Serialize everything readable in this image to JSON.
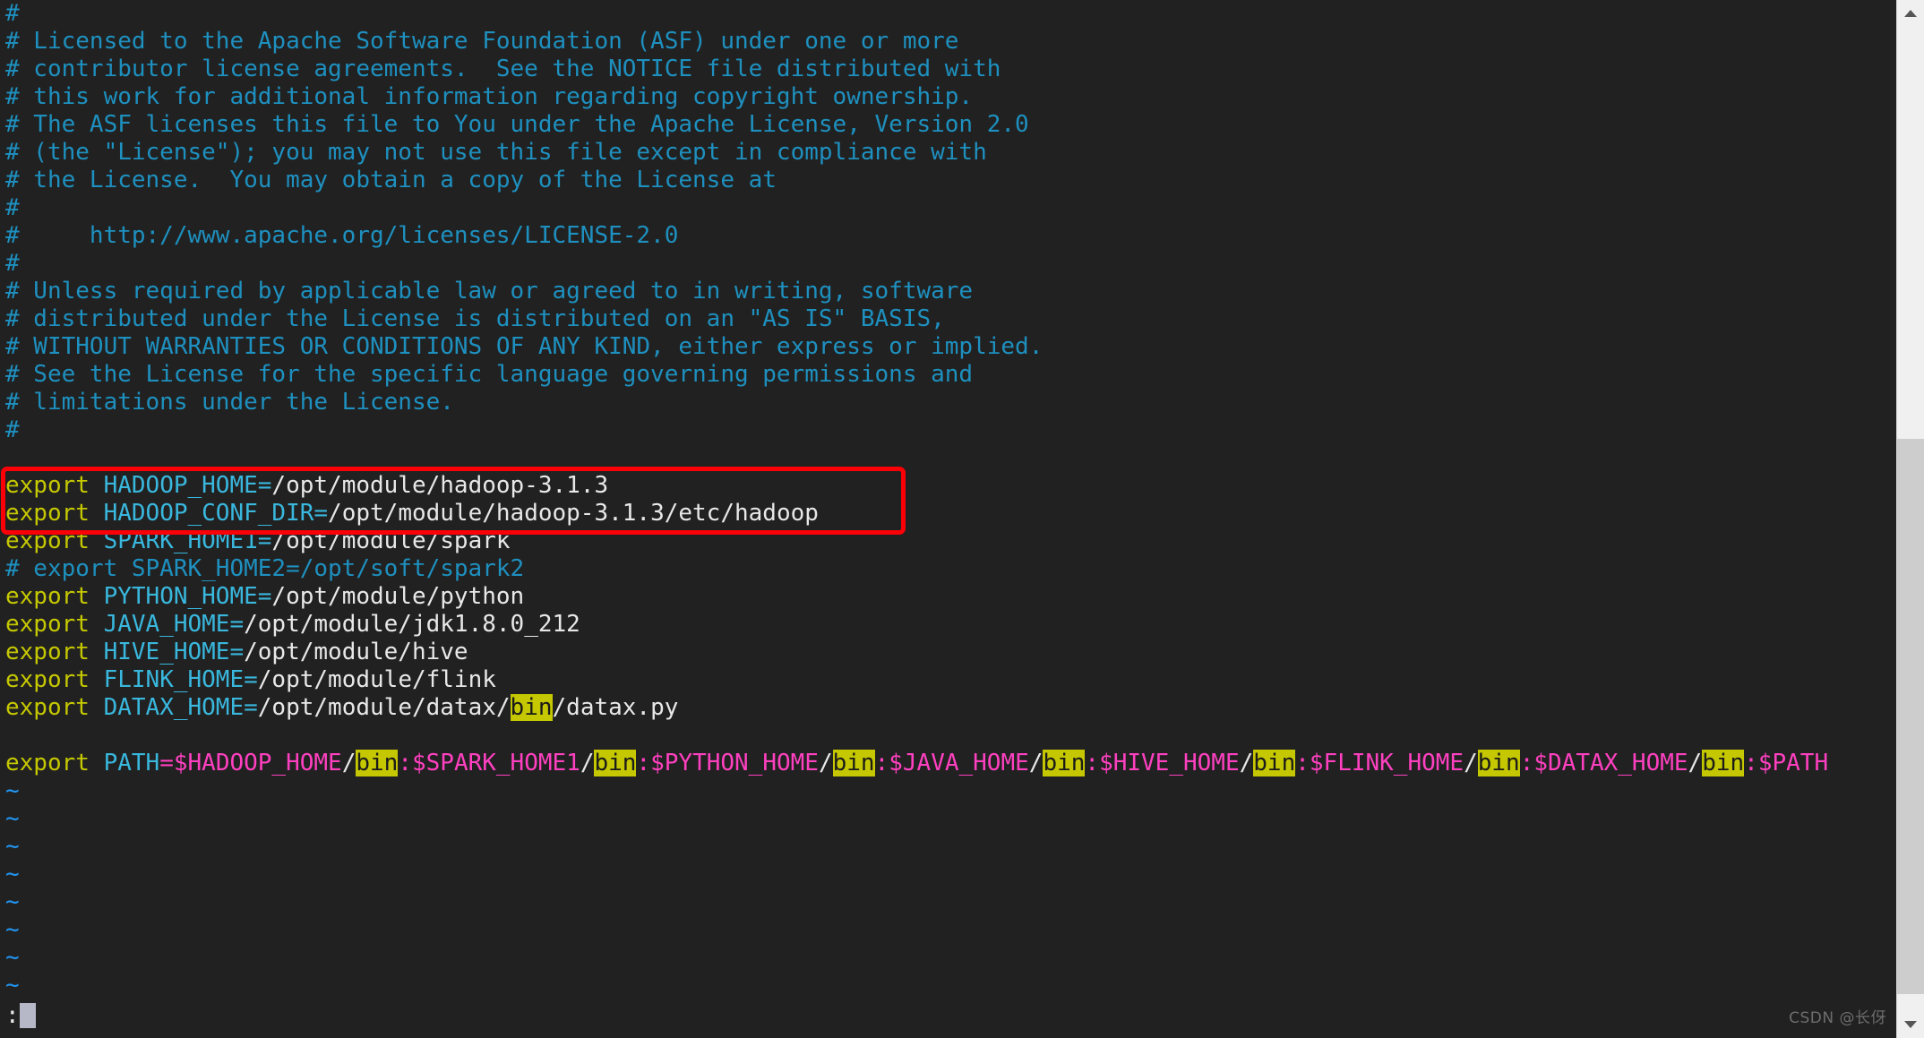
{
  "app": {
    "editor": "vim",
    "background_color": "#212121",
    "comment_color": "#1e90bf",
    "keyword_color": "#c5c800",
    "variable_color": "#39b7dd",
    "path_color": "#e8e8e8",
    "magenta_color": "#ff40c0",
    "highlight_bg": "#c5c800",
    "tilde_color": "#2196f3",
    "annotation_color": "#fb0007"
  },
  "comment_lines": [
    "#",
    "# Licensed to the Apache Software Foundation (ASF) under one or more",
    "# contributor license agreements.  See the NOTICE file distributed with",
    "# this work for additional information regarding copyright ownership.",
    "# The ASF licenses this file to You under the Apache License, Version 2.0",
    "# (the \"License\"); you may not use this file except in compliance with",
    "# the License.  You may obtain a copy of the License at",
    "#",
    "#     http://www.apache.org/licenses/LICENSE-2.0",
    "#",
    "# Unless required by applicable law or agreed to in writing, software",
    "# distributed under the License is distributed on an \"AS IS\" BASIS,",
    "# WITHOUT WARRANTIES OR CONDITIONS OF ANY KIND, either express or implied.",
    "# See the License for the specific language governing permissions and",
    "# limitations under the License.",
    "#"
  ],
  "export_lines": {
    "hadoop_home": {
      "keyword": "export",
      "variable": "HADOOP_HOME",
      "equals": "=",
      "value": "/opt/module/hadoop-3.1.3"
    },
    "hadoop_conf_dir": {
      "keyword": "export",
      "variable": "HADOOP_CONF_DIR",
      "equals": "=",
      "value": "/opt/module/hadoop-3.1.3/etc/hadoop"
    },
    "spark_home1": {
      "keyword": "export",
      "variable": "SPARK_HOME1",
      "equals": "=",
      "value": "/opt/module/spark"
    },
    "spark_home2_commented": "# export SPARK_HOME2=/opt/soft/spark2",
    "python_home": {
      "keyword": "export",
      "variable": "PYTHON_HOME",
      "equals": "=",
      "value": "/opt/module/python"
    },
    "java_home": {
      "keyword": "export",
      "variable": "JAVA_HOME",
      "equals": "=",
      "value": "/opt/module/jdk1.8.0_212"
    },
    "hive_home": {
      "keyword": "export",
      "variable": "HIVE_HOME",
      "equals": "=",
      "value": "/opt/module/hive"
    },
    "flink_home": {
      "keyword": "export",
      "variable": "FLINK_HOME",
      "equals": "=",
      "value": "/opt/module/flink"
    },
    "datax_home": {
      "keyword": "export",
      "variable": "DATAX_HOME",
      "equals": "=",
      "value_before": "/opt/module/datax/",
      "highlighted": "bin",
      "value_after": "/datax.py"
    }
  },
  "path_line": {
    "keyword": "export",
    "variable": "PATH",
    "equals": "=",
    "highlight_token": "bin",
    "segments": [
      "$HADOOP_HOME",
      "$SPARK_HOME1",
      "$PYTHON_HOME",
      "$JAVA_HOME",
      "$HIVE_HOME",
      "$FLINK_HOME",
      "$DATAX_HOME"
    ],
    "tail": "$PATH",
    "separator": ":",
    "slash": "/"
  },
  "empty_marker": "~",
  "empty_marker_count": 8,
  "status_line": {
    "prompt": ":",
    "cursor": "block"
  },
  "watermark": "CSDN @长伢",
  "annotation": {
    "type": "red-rectangle",
    "highlights_lines": [
      "HADOOP_HOME",
      "HADOOP_CONF_DIR"
    ]
  },
  "scrollbar": {
    "up_arrow": "scroll-up-arrow",
    "down_arrow": "scroll-down-arrow",
    "thumb": "scroll-thumb"
  }
}
